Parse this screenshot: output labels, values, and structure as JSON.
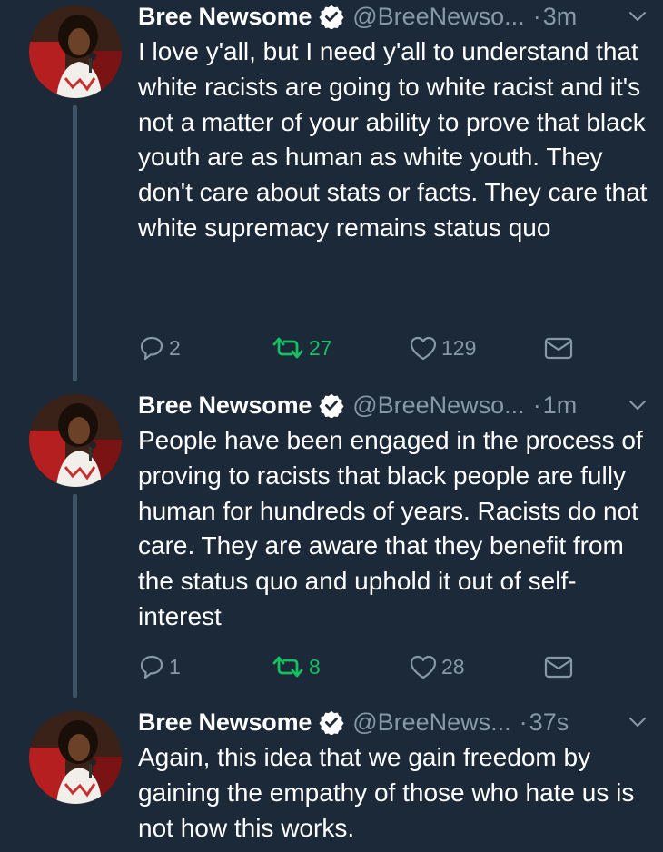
{
  "colors": {
    "background": "#1c2938",
    "text": "#ffffff",
    "muted": "#8899a6",
    "retweet": "#17bf63",
    "verified": "#ffffff",
    "thread_line": "#3d5466"
  },
  "icons": {
    "reply": "reply-icon",
    "retweet": "retweet-icon",
    "like": "heart-icon",
    "dm": "envelope-icon",
    "verified": "verified-badge-icon",
    "more": "chevron-down-icon"
  },
  "tweets": [
    {
      "name": "Bree Newsome",
      "handle": "@BreeNewso...",
      "separator": "·",
      "time": "3m",
      "text": "I love y'all, but I need y'all to understand that white racists are going to white racist and it's not a matter of your ability to prove that black youth are as human as white youth. They don't care about stats or facts. They care that white supremacy remains status quo",
      "replies": "2",
      "retweets": "27",
      "likes": "129"
    },
    {
      "name": "Bree Newsome",
      "handle": "@BreeNewso...",
      "separator": "·",
      "time": "1m",
      "text": "People have been engaged in the process of proving to racists that black people are fully human for hundreds of years. Racists do not care. They are aware that they benefit from the status quo and uphold it out of self-interest",
      "replies": "1",
      "retweets": "8",
      "likes": "28"
    },
    {
      "name": "Bree Newsome",
      "handle": "@BreeNews...",
      "separator": "·",
      "time": "37s",
      "text": "Again, this idea that we gain freedom by gaining the empathy of those who hate us is not how this works."
    }
  ]
}
